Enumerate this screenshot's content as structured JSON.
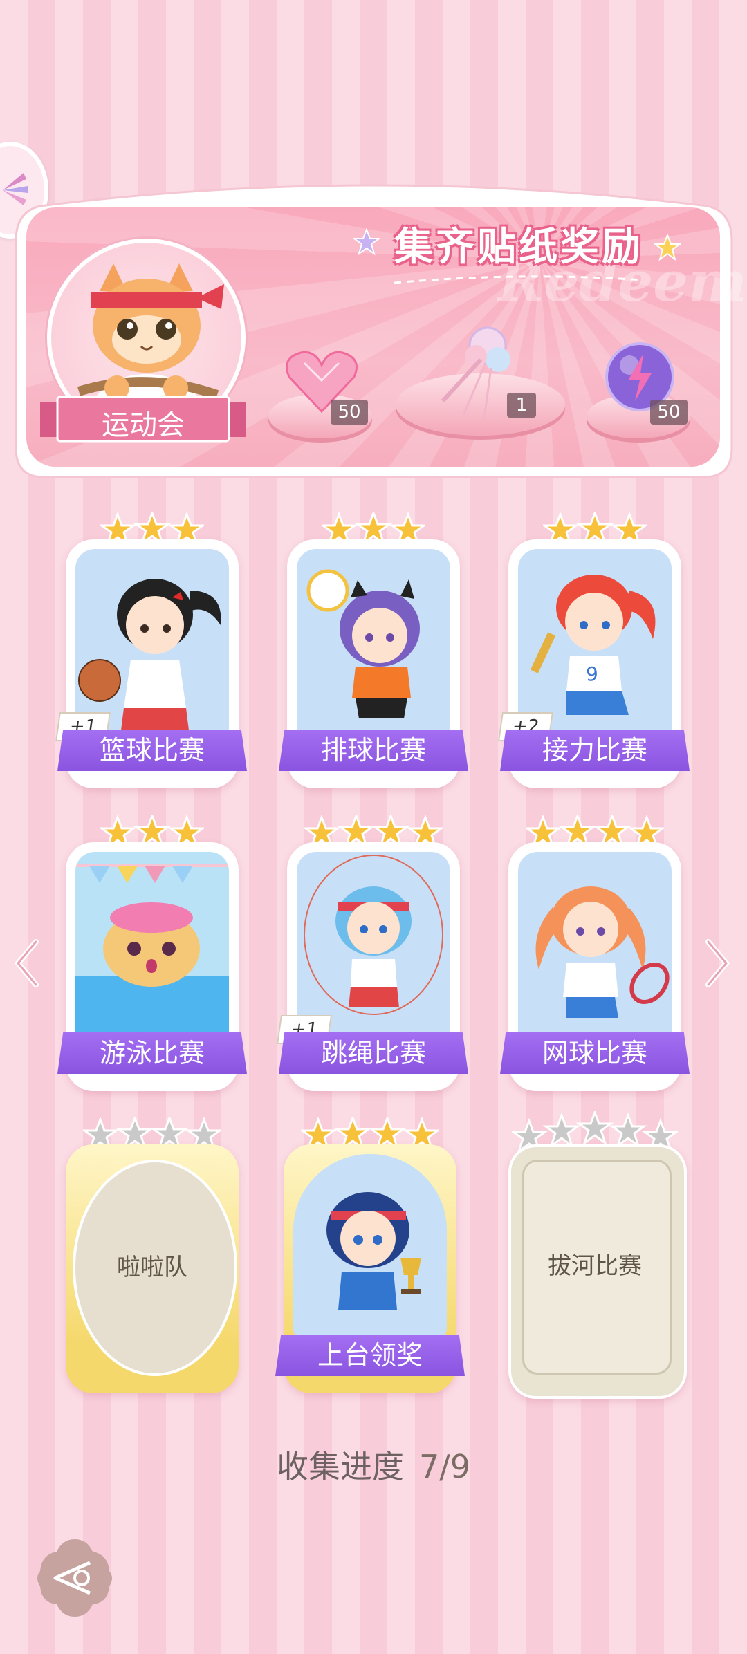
{
  "banner": {
    "title": "集齐贴纸奖励",
    "watermark": "Redeem",
    "event_label": "运动会",
    "rewards": [
      {
        "icon": "heart-gem-icon",
        "count": "50"
      },
      {
        "icon": "bouquet-icon",
        "count": "1"
      },
      {
        "icon": "energy-orb-icon",
        "count": "50"
      }
    ]
  },
  "cards": [
    {
      "label": "篮球比赛",
      "stars": 3,
      "bonus": "+1",
      "unlocked": true
    },
    {
      "label": "排球比赛",
      "stars": 3,
      "bonus": "",
      "unlocked": true
    },
    {
      "label": "接力比赛",
      "stars": 3,
      "bonus": "+2",
      "unlocked": true
    },
    {
      "label": "游泳比赛",
      "stars": 3,
      "bonus": "",
      "unlocked": true
    },
    {
      "label": "跳绳比赛",
      "stars": 4,
      "bonus": "+1",
      "unlocked": true
    },
    {
      "label": "网球比赛",
      "stars": 4,
      "bonus": "",
      "unlocked": true
    },
    {
      "label": "啦啦队",
      "stars": 4,
      "filled_stars": 0,
      "unlocked": false
    },
    {
      "label": "上台领奖",
      "stars": 4,
      "unlocked": true
    },
    {
      "label": "拔河比赛",
      "stars": 5,
      "filled_stars": 0,
      "unlocked": false
    }
  ],
  "progress": {
    "label": "收集进度",
    "value": "7/9"
  },
  "colors": {
    "label_purple": "#9a62ea",
    "banner_pink": "#f9a9bc",
    "star_gold": "#f7c23a"
  }
}
